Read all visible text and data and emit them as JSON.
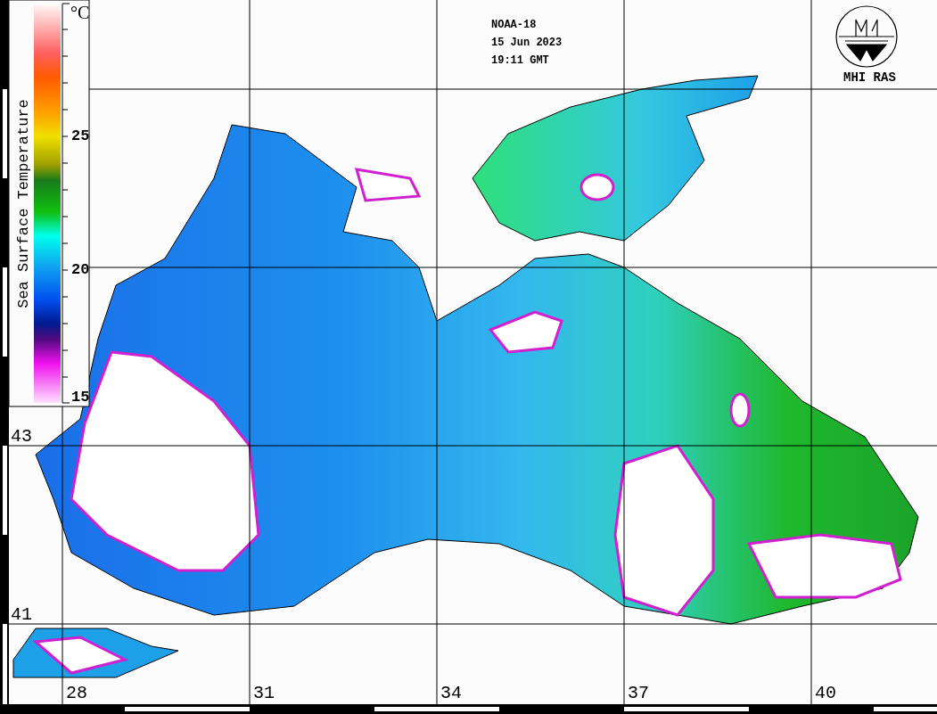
{
  "header": {
    "satellite": "NOAA-18",
    "date": "15 Jun 2023",
    "time": "19:11 GMT"
  },
  "logo": {
    "label": "MHI RAS"
  },
  "colorbar": {
    "title": "Sea Surface Temperature",
    "unit": "°C",
    "ticks": [
      "25",
      "20",
      "15"
    ]
  },
  "latitude_labels": [
    "43",
    "41"
  ],
  "longitude_labels": [
    "28",
    "31",
    "34",
    "37",
    "40"
  ]
}
